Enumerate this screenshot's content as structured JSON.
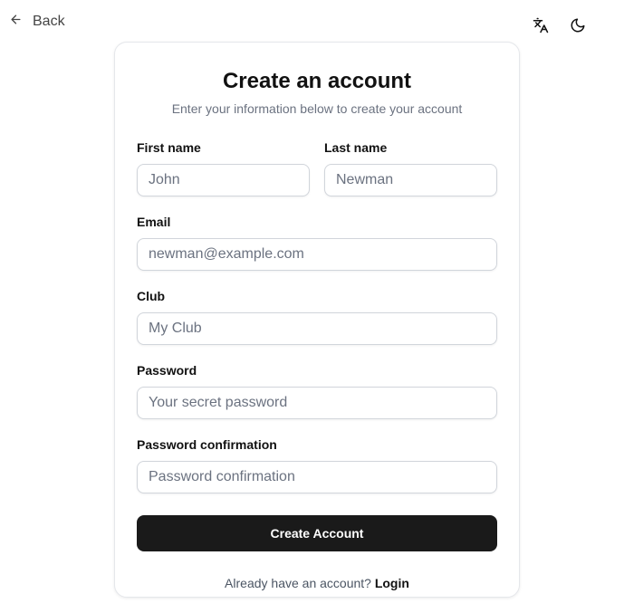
{
  "nav": {
    "back_label": "Back"
  },
  "icons": {
    "back": "arrow-left-icon",
    "translate": "translate-icon",
    "theme": "moon-icon"
  },
  "card": {
    "title": "Create an account",
    "subtitle": "Enter your information below to create your account"
  },
  "form": {
    "first_name": {
      "label": "First name",
      "placeholder": "John",
      "value": ""
    },
    "last_name": {
      "label": "Last name",
      "placeholder": "Newman",
      "value": ""
    },
    "email": {
      "label": "Email",
      "placeholder": "newman@example.com",
      "value": ""
    },
    "club": {
      "label": "Club",
      "placeholder": "My Club",
      "value": ""
    },
    "password": {
      "label": "Password",
      "placeholder": "Your secret password",
      "value": ""
    },
    "password_confirmation": {
      "label": "Password confirmation",
      "placeholder": "Password confirmation",
      "value": ""
    }
  },
  "actions": {
    "submit_label": "Create Account",
    "login_prompt": "Already have an account?",
    "login_label": "Login"
  },
  "colors": {
    "primary_button": "#1a1a1a",
    "muted_text": "#6b7280",
    "border": "#d1d5db"
  }
}
